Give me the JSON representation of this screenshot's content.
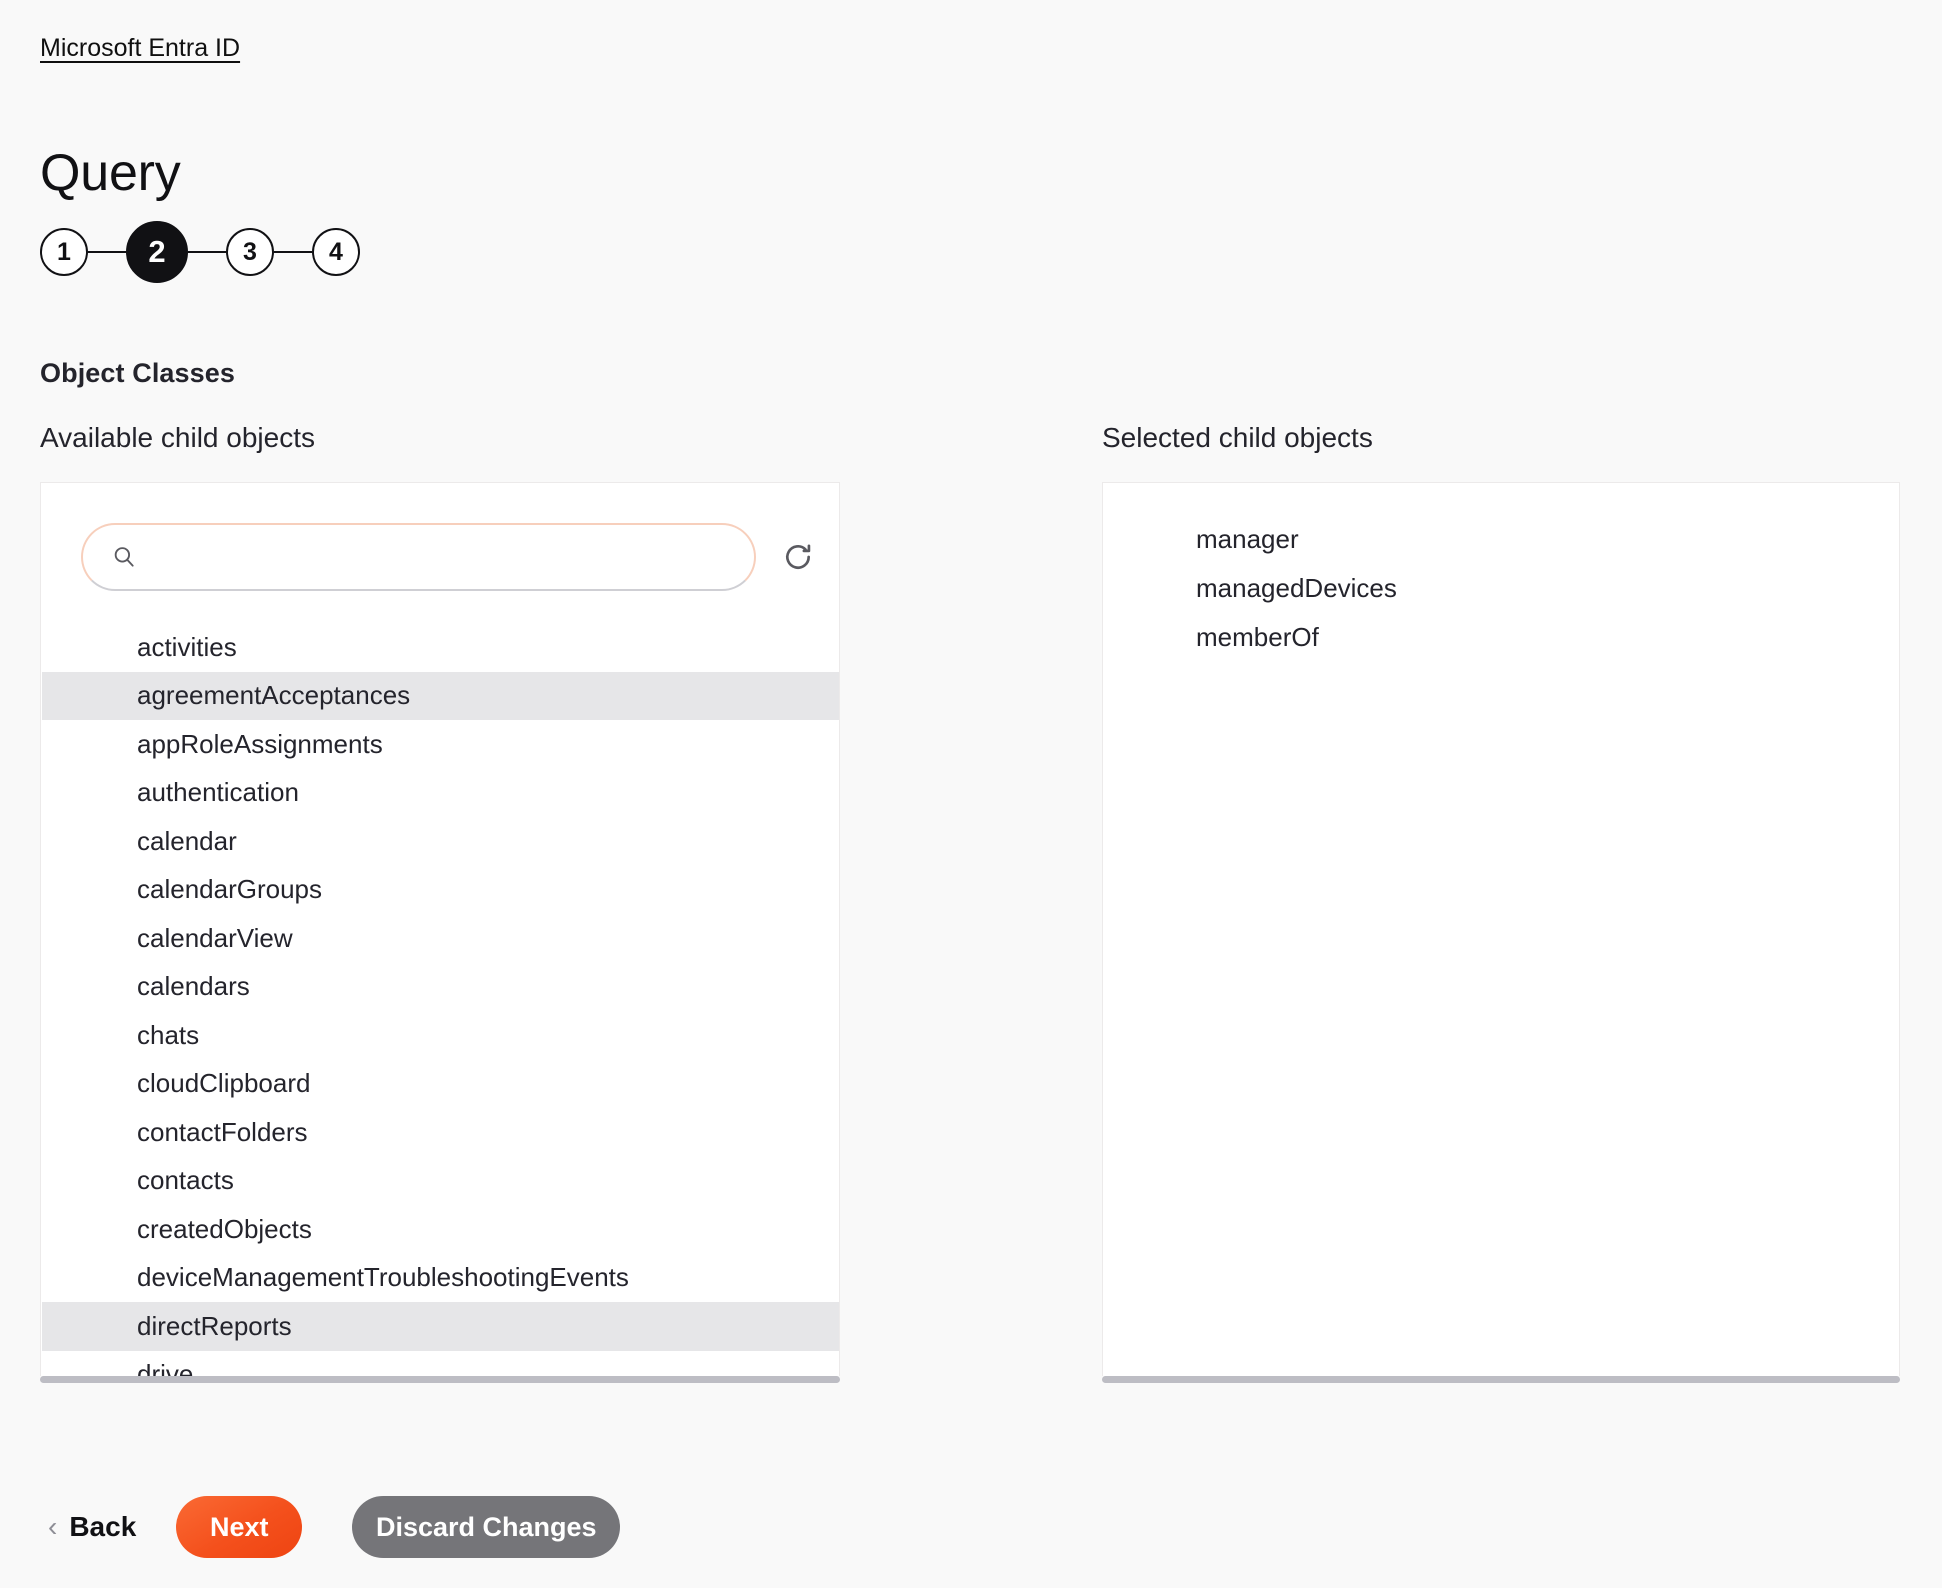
{
  "breadcrumb": {
    "label": "Microsoft Entra ID"
  },
  "header": {
    "title": "Query"
  },
  "stepper": {
    "steps": [
      {
        "label": "1",
        "active": false
      },
      {
        "label": "2",
        "active": true
      },
      {
        "label": "3",
        "active": false
      },
      {
        "label": "4",
        "active": false
      }
    ]
  },
  "section": {
    "title": "Object Classes"
  },
  "available": {
    "label": "Available child objects",
    "search": {
      "value": "",
      "placeholder": "",
      "icon": "search-icon"
    },
    "refresh": {
      "icon": "refresh-icon"
    },
    "items": [
      {
        "label": "activities",
        "highlighted": false
      },
      {
        "label": "agreementAcceptances",
        "highlighted": true
      },
      {
        "label": "appRoleAssignments",
        "highlighted": false
      },
      {
        "label": "authentication",
        "highlighted": false
      },
      {
        "label": "calendar",
        "highlighted": false
      },
      {
        "label": "calendarGroups",
        "highlighted": false
      },
      {
        "label": "calendarView",
        "highlighted": false
      },
      {
        "label": "calendars",
        "highlighted": false
      },
      {
        "label": "chats",
        "highlighted": false
      },
      {
        "label": "cloudClipboard",
        "highlighted": false
      },
      {
        "label": "contactFolders",
        "highlighted": false
      },
      {
        "label": "contacts",
        "highlighted": false
      },
      {
        "label": "createdObjects",
        "highlighted": false
      },
      {
        "label": "deviceManagementTroubleshootingEvents",
        "highlighted": false
      },
      {
        "label": "directReports",
        "highlighted": true
      },
      {
        "label": "drive",
        "highlighted": false
      }
    ]
  },
  "selected": {
    "label": "Selected child objects",
    "items": [
      {
        "label": "manager"
      },
      {
        "label": "managedDevices"
      },
      {
        "label": "memberOf"
      }
    ]
  },
  "footer": {
    "back_label": "Back",
    "next_label": "Next",
    "discard_label": "Discard Changes"
  },
  "colors": {
    "accent": "#f4501c",
    "discard": "#757579",
    "active_step": "#111114",
    "highlight_row": "#e6e6e8",
    "search_border": "#f7cfbc",
    "page_bg": "#f9f9f9"
  }
}
